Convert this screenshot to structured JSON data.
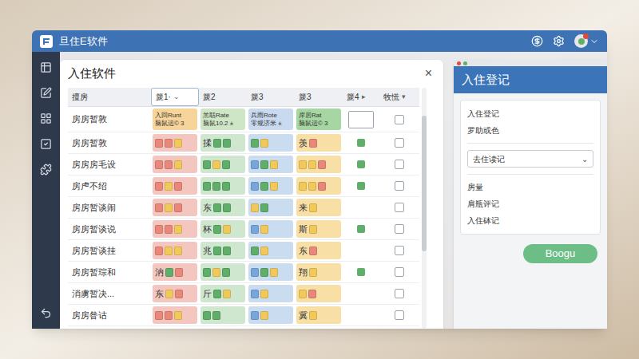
{
  "window": {
    "title": "旦住E软件"
  },
  "main_panel": {
    "title": "入住软件",
    "close": "×"
  },
  "table": {
    "columns": [
      {
        "label": "擅房",
        "selected": false,
        "arrow": ""
      },
      {
        "label": "篪1·",
        "selected": true,
        "arrow": "⌄"
      },
      {
        "label": "篪2",
        "selected": false,
        "arrow": ""
      },
      {
        "label": "篪3",
        "selected": false,
        "arrow": ""
      },
      {
        "label": "篪3",
        "selected": false,
        "arrow": ""
      },
      {
        "label": "篪4",
        "selected": false,
        "arrow": "▸"
      },
      {
        "label": "牧慌",
        "selected": false,
        "arrow": "▾"
      }
    ],
    "rows": [
      {
        "name": "房房暂敦",
        "checked": false,
        "mark": {
          "kind": "box"
        },
        "cells": [
          {
            "color": "#f6d49a",
            "lines": [
              "入回Runt",
              "脑鼠运© 3"
            ],
            "squares": []
          },
          {
            "color": "#cfe6c6",
            "lines": [
              "羔聒Rate",
              "脑鼠10.2 ±"
            ],
            "squares": []
          },
          {
            "color": "#c9daf0",
            "lines": [
              "兵雨Rote",
              "零规济米 ±"
            ],
            "squares": []
          },
          {
            "color": "#a6d6a2",
            "lines": [
              "岸居Rat",
              "脑鼠运© 3"
            ],
            "squares": []
          }
        ]
      },
      {
        "name": "房房暂敦",
        "checked": false,
        "mark": {
          "kind": "dot",
          "color": "#5fae6a"
        },
        "cells": [
          {
            "color": "#f3c6bf",
            "lines": [],
            "squares": [
              "#e8877a",
              "#e8877a",
              "#f1c95b"
            ]
          },
          {
            "color": "#cfe6cf",
            "lines": [
              "揉"
            ],
            "squares": [
              "#5fae6a",
              "#5fae6a"
            ]
          },
          {
            "color": "#c9dcf0",
            "lines": [],
            "squares": [
              "#5fae6a",
              "#f1c95b"
            ]
          },
          {
            "color": "#f7dfa5",
            "lines": [
              "羡"
            ],
            "squares": [
              "#e8877a"
            ]
          }
        ]
      },
      {
        "name": "房房房毛设",
        "checked": false,
        "mark": {
          "kind": "dot",
          "color": "#5fae6a"
        },
        "cells": [
          {
            "color": "#f3c6bf",
            "lines": [],
            "squares": [
              "#e8877a",
              "#e8877a",
              "#f1c95b"
            ]
          },
          {
            "color": "#cfe6cf",
            "lines": [],
            "squares": [
              "#5fae6a",
              "#f1c95b",
              "#5fae6a"
            ]
          },
          {
            "color": "#c9dcf0",
            "lines": [],
            "squares": [
              "#79a6d9",
              "#5fae6a",
              "#f1c95b"
            ]
          },
          {
            "color": "#f7dfa5",
            "lines": [],
            "squares": [
              "#f1c95b",
              "#f1c95b",
              "#e8877a"
            ]
          }
        ]
      },
      {
        "name": "房虍不绍",
        "checked": false,
        "mark": {
          "kind": "dot",
          "color": "#5fae6a"
        },
        "cells": [
          {
            "color": "#f3c6bf",
            "lines": [],
            "squares": [
              "#e8877a",
              "#f1c95b",
              "#e8877a"
            ]
          },
          {
            "color": "#cfe6cf",
            "lines": [],
            "squares": [
              "#5fae6a",
              "#5fae6a",
              "#5fae6a"
            ]
          },
          {
            "color": "#c9dcf0",
            "lines": [],
            "squares": [
              "#79a6d9",
              "#5fae6a",
              "#f1c95b"
            ]
          },
          {
            "color": "#f7dfa5",
            "lines": [],
            "squares": [
              "#f1c95b",
              "#f1c95b",
              "#e8877a"
            ]
          }
        ]
      },
      {
        "name": "房房暂谈闹",
        "checked": false,
        "mark": {
          "kind": "none"
        },
        "cells": [
          {
            "color": "#f3c6bf",
            "lines": [],
            "squares": [
              "#e8877a",
              "#f1c95b",
              "#e8877a"
            ]
          },
          {
            "color": "#cfe6cf",
            "lines": [
              "东"
            ],
            "squares": [
              "#5fae6a",
              "#5fae6a"
            ]
          },
          {
            "color": "#c9dcf0",
            "lines": [],
            "squares": [
              "#f1c95b",
              "#5fae6a"
            ]
          },
          {
            "color": "#f7dfa5",
            "lines": [
              "来"
            ],
            "squares": [
              "#f1c95b"
            ]
          }
        ]
      },
      {
        "name": "房房暂谈说",
        "checked": false,
        "mark": {
          "kind": "dot",
          "color": "#5fae6a"
        },
        "cells": [
          {
            "color": "#f3c6bf",
            "lines": [],
            "squares": [
              "#e8877a",
              "#e8877a",
              "#f1c95b"
            ]
          },
          {
            "color": "#cfe6cf",
            "lines": [
              "杯"
            ],
            "squares": [
              "#5fae6a",
              "#f1c95b"
            ]
          },
          {
            "color": "#c9dcf0",
            "lines": [],
            "squares": [
              "#79a6d9",
              "#f1c95b"
            ]
          },
          {
            "color": "#f7dfa5",
            "lines": [
              "斯"
            ],
            "squares": [
              "#f1c95b"
            ]
          }
        ]
      },
      {
        "name": "房房暂谈挂",
        "checked": false,
        "mark": {
          "kind": "none"
        },
        "cells": [
          {
            "color": "#f3c6bf",
            "lines": [],
            "squares": [
              "#e8877a",
              "#f1c95b",
              "#f1c95b"
            ]
          },
          {
            "color": "#cfe6cf",
            "lines": [
              "兆"
            ],
            "squares": [
              "#5fae6a",
              "#5fae6a"
            ]
          },
          {
            "color": "#c9dcf0",
            "lines": [],
            "squares": [
              "#5fae6a",
              "#f1c95b"
            ]
          },
          {
            "color": "#f7dfa5",
            "lines": [
              "东"
            ],
            "squares": [
              "#e8877a"
            ]
          }
        ]
      },
      {
        "name": "房房暂琮和",
        "checked": false,
        "mark": {
          "kind": "dot",
          "color": "#5fae6a"
        },
        "cells": [
          {
            "color": "#f3c6bf",
            "lines": [
              "汭"
            ],
            "squares": [
              "#5fae6a",
              "#e8877a"
            ]
          },
          {
            "color": "#cfe6cf",
            "lines": [],
            "squares": [
              "#5fae6a",
              "#f1c95b",
              "#5fae6a"
            ]
          },
          {
            "color": "#c9dcf0",
            "lines": [],
            "squares": [
              "#79a6d9",
              "#5fae6a",
              "#f1c95b"
            ]
          },
          {
            "color": "#f7dfa5",
            "lines": [
              "翔"
            ],
            "squares": [
              "#f1c95b"
            ]
          }
        ]
      },
      {
        "name": "消虜暂决...",
        "checked": false,
        "mark": {
          "kind": "none"
        },
        "cells": [
          {
            "color": "#f3c6bf",
            "lines": [
              "东"
            ],
            "squares": [
              "#f1c95b",
              "#e8877a"
            ]
          },
          {
            "color": "#cfe6cf",
            "lines": [
              "斤"
            ],
            "squares": [
              "#5fae6a",
              "#f1c95b"
            ]
          },
          {
            "color": "#c9dcf0",
            "lines": [],
            "squares": [
              "#79a6d9",
              "#f1c95b"
            ]
          },
          {
            "color": "#f7dfa5",
            "lines": [],
            "squares": [
              "#f1c95b",
              "#e8877a"
            ]
          }
        ]
      },
      {
        "name": "房房昝诂",
        "checked": false,
        "mark": {
          "kind": "none"
        },
        "cells": [
          {
            "color": "#f3c6bf",
            "lines": [],
            "squares": [
              "#e8877a",
              "#e8877a",
              "#f1c95b"
            ]
          },
          {
            "color": "#cfe6cf",
            "lines": [],
            "squares": [
              "#5fae6a",
              "#5fae6a"
            ]
          },
          {
            "color": "#c9dcf0",
            "lines": [],
            "squares": [
              "#79a6d9",
              "#f1c95b"
            ]
          },
          {
            "color": "#f7dfa5",
            "lines": [
              "冀"
            ],
            "squares": [
              "#f1c95b"
            ]
          }
        ]
      }
    ]
  },
  "right_panel": {
    "title": "入住登记",
    "items": [
      "入住登记",
      "罗助或色"
    ],
    "select": {
      "value": "去住读记",
      "arrow": "⌄"
    },
    "fields": [
      "房量",
      "肩瓶评记",
      "入住砵记"
    ],
    "button": "Boogu"
  }
}
